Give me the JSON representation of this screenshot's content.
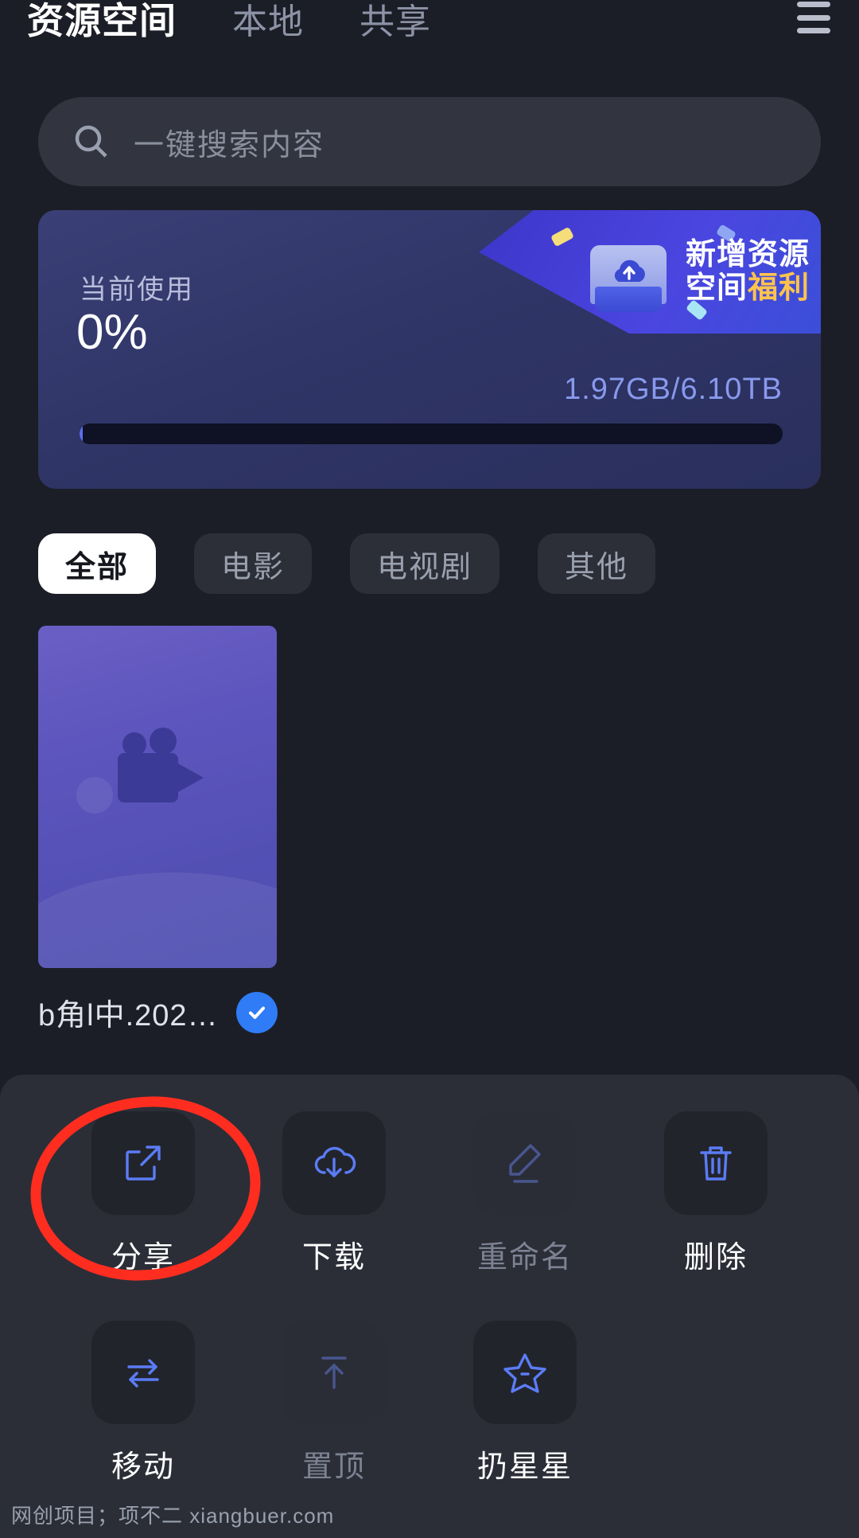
{
  "header": {
    "tabs": [
      {
        "label": "资源空间",
        "active": true
      },
      {
        "label": "本地",
        "active": false
      },
      {
        "label": "共享",
        "active": false
      }
    ],
    "menu_icon": "hamburger-menu-icon"
  },
  "search": {
    "icon": "search-icon",
    "placeholder": "一键搜索内容",
    "value": ""
  },
  "storage": {
    "usage_label": "当前使用",
    "usage_percent": "0%",
    "usage_percent_value": 0,
    "total_text": "1.97GB/6.10TB",
    "used": "1.97GB",
    "capacity": "6.10TB",
    "promo": {
      "line1": "新增资源",
      "line2_prefix": "空间",
      "line2_highlight": "福利",
      "icon": "cloud-upload-card-icon"
    },
    "accent_color": "#5b6ff0",
    "total_text_color": "#8899ee",
    "highlight_color": "#ffc34d"
  },
  "filters": [
    {
      "label": "全部",
      "active": true
    },
    {
      "label": "电影",
      "active": false
    },
    {
      "label": "电视剧",
      "active": false
    },
    {
      "label": "其他",
      "active": false
    }
  ],
  "files": [
    {
      "name": "b角l中.202…",
      "thumb_icon": "video-camera-icon",
      "selected": true,
      "check_icon": "check-icon",
      "check_color": "#2f7cf6"
    }
  ],
  "action_sheet": {
    "actions": [
      {
        "label": "分享",
        "icon": "external-link-icon",
        "enabled": true,
        "highlighted": true
      },
      {
        "label": "下载",
        "icon": "cloud-download-icon",
        "enabled": true,
        "highlighted": false
      },
      {
        "label": "重命名",
        "icon": "pencil-edit-icon",
        "enabled": false,
        "highlighted": false
      },
      {
        "label": "删除",
        "icon": "trash-icon",
        "enabled": true,
        "highlighted": false
      },
      {
        "label": "移动",
        "icon": "swap-arrows-icon",
        "enabled": true,
        "highlighted": false
      },
      {
        "label": "置顶",
        "icon": "pin-to-top-icon",
        "enabled": false,
        "highlighted": false
      },
      {
        "label": "扔星星",
        "icon": "star-outline-icon",
        "enabled": true,
        "highlighted": false
      }
    ]
  },
  "annotation": {
    "shape": "red-circle",
    "color": "#ff2d20",
    "targets": "分享"
  },
  "watermark": {
    "text": "网创项目；项不二 xiangbuer.com"
  }
}
